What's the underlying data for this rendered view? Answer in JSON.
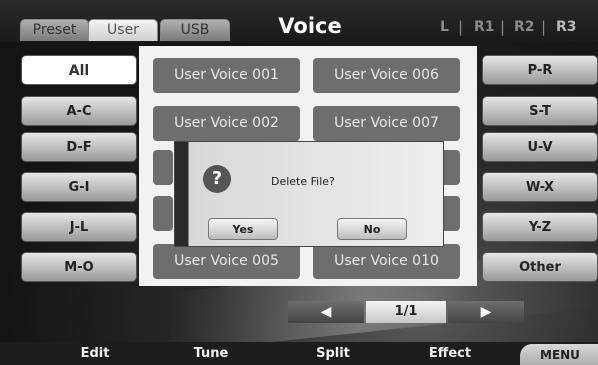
{
  "header": {
    "tabs": [
      "Preset",
      "User",
      "USB"
    ],
    "active_tab": "User",
    "title": "Voice",
    "layers": [
      {
        "label": "L",
        "color": "#8a8a8a"
      },
      {
        "label": "R1",
        "color": "#8a8a8a"
      },
      {
        "label": "R2",
        "color": "#8a8a8a"
      },
      {
        "label": "R3",
        "color": "#b8b8b8"
      }
    ],
    "separator": "|"
  },
  "left_categories": [
    "All",
    "A-C",
    "D-F",
    "G-I",
    "J-L",
    "M-O"
  ],
  "right_categories": [
    "P-R",
    "S-T",
    "U-V",
    "W-X",
    "Y-Z",
    "Other"
  ],
  "selected_category": "All",
  "voices": {
    "left_column": [
      "User Voice 001",
      "User Voice 002",
      "User Voice 005"
    ],
    "right_column": [
      "User Voice 006",
      "User Voice 007",
      "User Voice 010"
    ]
  },
  "dialog": {
    "icon": "question-icon",
    "icon_glyph": "?",
    "message": "Delete File?",
    "yes_label": "Yes",
    "no_label": "No"
  },
  "pager": {
    "prev_glyph": "◀",
    "page_label": "1/1",
    "next_glyph": "▶"
  },
  "function_keys": [
    "Edit",
    "Tune",
    "Split",
    "Effect"
  ],
  "menu_label": "MENU"
}
